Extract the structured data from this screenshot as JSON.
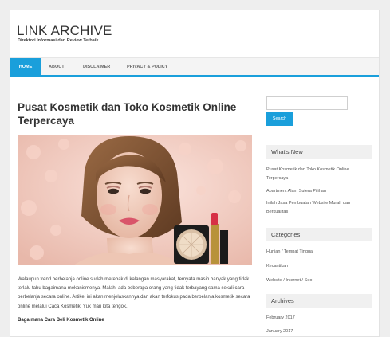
{
  "site": {
    "title": "LINK ARCHIVE",
    "description": "Direktori Informasi dan Review Terbaik"
  },
  "nav": {
    "items": [
      {
        "label": "HOME"
      },
      {
        "label": "ABOUT"
      },
      {
        "label": "DISCLAIMER"
      },
      {
        "label": "PRIVACY & POLICY"
      }
    ]
  },
  "post": {
    "title": "Pusat Kosmetik dan Toko Kosmetik Online Terpercaya",
    "paragraphs": [
      "Walaupun trend berbelanja online sudah merebak di kalangan masyarakat, ternyata masih banyak yang tidak terlalu tahu bagaimana mekanismenya. Malah, ada beberapa orang yang tidak terbayang sama sekali cara berbelanja secara online. Artikel ini akan menjelaskannya dan akan terfokus pada berbelanja kosmetik secara online melalui Caca Kosmetik. Yuk mari kita tengok."
    ],
    "subheading": "Bagaimana Cara Beli Kosmetik Online"
  },
  "sidebar": {
    "search_button": "Search",
    "whats_new": {
      "title": "What's New",
      "items": [
        "Pusat Kosmetik dan Toko Kosmetik Online Terpercaya",
        "Apartment Alam Sutera Pilihan",
        "Inilah Jasa Pembuatan Website Murah dan Berkualitas"
      ]
    },
    "categories": {
      "title": "Categories",
      "items": [
        "Hunian / Tempat Tinggal",
        "Kecantikan",
        "Website / Internet / Seo"
      ]
    },
    "archives": {
      "title": "Archives",
      "items": [
        "February 2017",
        "January 2017"
      ]
    }
  },
  "colors": {
    "accent": "#1a9fdb",
    "widget_bg": "#f0f0f0"
  }
}
